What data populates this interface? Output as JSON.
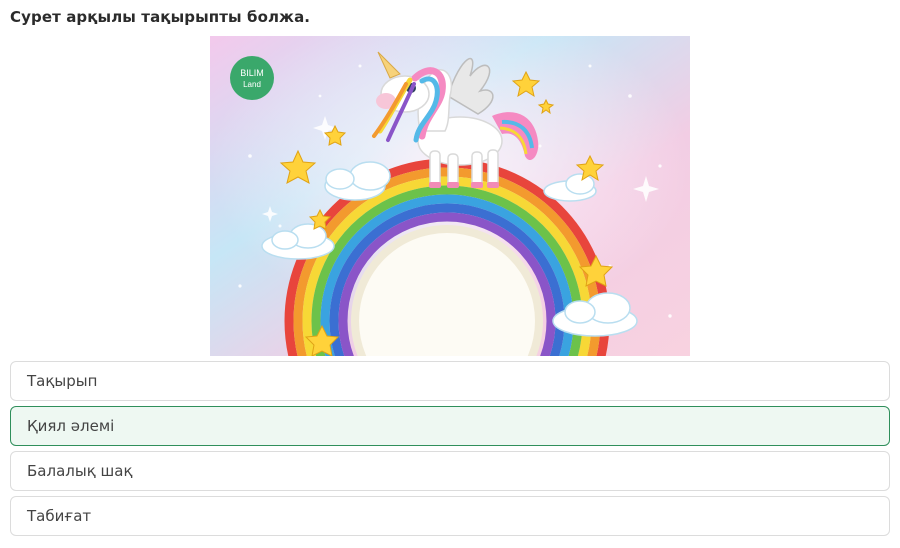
{
  "question": {
    "text": "Сурет арқылы тақырыпты болжа."
  },
  "image": {
    "logo_line1": "BILIM",
    "logo_line2": "Land",
    "colors": {
      "logo_badge": "#3aa86b",
      "background_pink": "#f6cde6",
      "background_blue": "#bfe8f4",
      "star": "#ffd23a"
    }
  },
  "options": [
    {
      "label": "Тақырып",
      "selected": false
    },
    {
      "label": "Қиял әлемі",
      "selected": true
    },
    {
      "label": "Балалық шақ",
      "selected": false
    },
    {
      "label": "Табиғат",
      "selected": false
    }
  ],
  "colors": {
    "selected_border": "#2f8f5b",
    "selected_background": "#eef8f2"
  }
}
